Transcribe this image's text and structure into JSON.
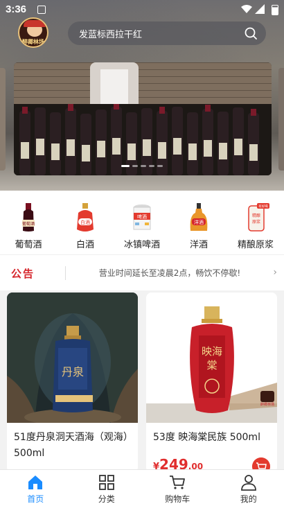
{
  "status_bar": {
    "time": "3:36"
  },
  "header": {
    "logo_text": "醉卿林场",
    "search_placeholder": "发蓝标西拉干红"
  },
  "banner": {
    "slide_count": 5,
    "active_index": 0
  },
  "categories": [
    {
      "label": "葡萄酒",
      "icon": "red-wine-bottle-icon",
      "badge": "葡萄酒"
    },
    {
      "label": "白酒",
      "icon": "baijiu-bottle-icon",
      "badge": "白酒"
    },
    {
      "label": "冰镇啤酒",
      "icon": "beer-can-icon",
      "badge": "啤酒"
    },
    {
      "label": "洋酒",
      "icon": "spirits-bottle-icon",
      "badge": "洋酒"
    },
    {
      "label": "精酿原浆",
      "icon": "craft-beer-icon",
      "badge": "精酿原浆",
      "tag": "有好喝"
    }
  ],
  "notice": {
    "badge": "公告",
    "text": "营业时间延长至凌晨2点，畅饮不停歇!"
  },
  "products": [
    {
      "title": "51度丹泉洞天酒海（观海）500ml",
      "price_symbol": "",
      "price_int": "",
      "price_dec": "",
      "label_text": "丹泉"
    },
    {
      "title": "53度 映海棠民族 500ml",
      "price_symbol": "¥",
      "price_int": "249",
      "price_dec": ".00",
      "label_text": "映海棠",
      "watermark": "醉卿林场"
    }
  ],
  "tabbar": [
    {
      "label": "首页",
      "icon": "home-icon",
      "active": true
    },
    {
      "label": "分类",
      "icon": "grid-icon",
      "active": false
    },
    {
      "label": "购物车",
      "icon": "cart-icon",
      "active": false
    },
    {
      "label": "我的",
      "icon": "user-icon",
      "active": false
    }
  ],
  "colors": {
    "accent_blue": "#1a8cff",
    "price_red": "#e02e2e",
    "notice_red": "#d6262c"
  }
}
